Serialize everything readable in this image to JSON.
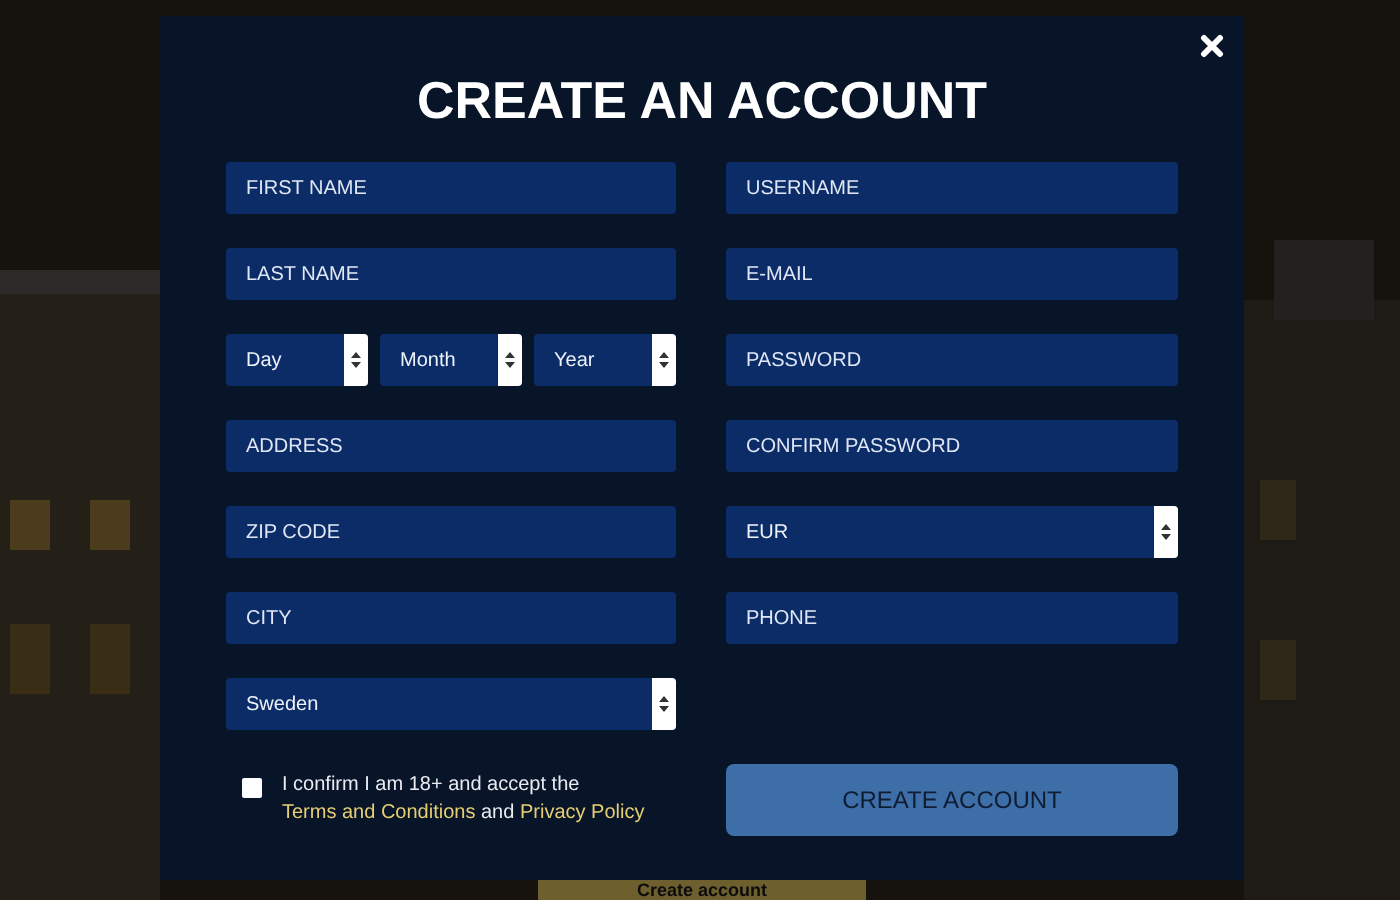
{
  "background": {
    "button": "Create account"
  },
  "dialog": {
    "title": "CREATE AN ACCOUNT"
  },
  "left_fields": [
    {
      "kind": "input",
      "placeholder": "FIRST NAME"
    },
    {
      "kind": "input",
      "placeholder": "LAST NAME"
    },
    {
      "kind": "date",
      "selects": [
        "Day",
        "Month",
        "Year"
      ]
    },
    {
      "kind": "input",
      "placeholder": "ADDRESS"
    },
    {
      "kind": "input",
      "placeholder": "ZIP CODE"
    },
    {
      "kind": "input",
      "placeholder": "CITY"
    },
    {
      "kind": "select",
      "value": "Sweden"
    }
  ],
  "right_fields": [
    {
      "kind": "input",
      "placeholder": "USERNAME"
    },
    {
      "kind": "input",
      "placeholder": "E-MAIL"
    },
    {
      "kind": "input",
      "placeholder": "PASSWORD"
    },
    {
      "kind": "input",
      "placeholder": "CONFIRM PASSWORD"
    },
    {
      "kind": "select",
      "value": "EUR"
    },
    {
      "kind": "input",
      "placeholder": "PHONE"
    }
  ],
  "consent": {
    "checked": false,
    "text": "I confirm I am 18+ and accept the ",
    "terms_link": "Terms and Conditions",
    "joiner": " and ",
    "privacy_link": "Privacy Policy"
  },
  "submit": "CREATE ACCOUNT"
}
